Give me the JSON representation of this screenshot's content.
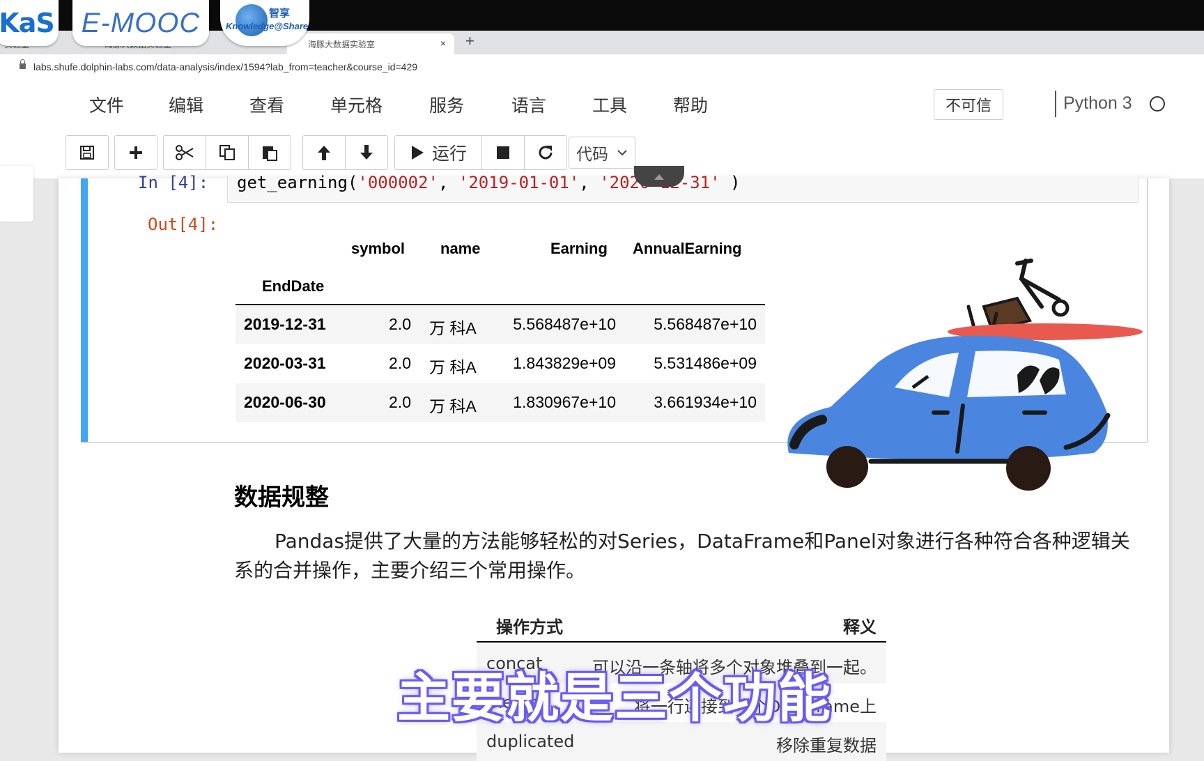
{
  "logos": {
    "kas": "KaS",
    "emooc": "E-MOOC",
    "ks_cn": "智享",
    "ks_en": "Knowledge@Share"
  },
  "browser": {
    "tabs": [
      "实验室",
      "海豚大数据实验室",
      "海豚大数据实验室"
    ],
    "active_tab_close": "×",
    "new_tab": "+",
    "url": "labs.shufe.dolphin-labs.com/data-analysis/index/1594?lab_from=teacher&course_id=429"
  },
  "menu": [
    "文件",
    "编辑",
    "查看",
    "单元格",
    "服务",
    "语言",
    "工具",
    "帮助"
  ],
  "trust_label": "不可信",
  "kernel_name": "Python 3",
  "toolbar": {
    "run_label": "运行",
    "cell_type": "代码"
  },
  "cell": {
    "in_prompt": "In  [4]:",
    "code_fn": "get_earning(",
    "code_arg1": "'000002'",
    "code_arg2": "'2019-01-01'",
    "code_arg3": "'2020-12-31'",
    "code_sep": ", ",
    "code_end": ")",
    "out_prompt": "Out[4]:"
  },
  "dataframe": {
    "columns": [
      "symbol",
      "name",
      "Earning",
      "AnnualEarning"
    ],
    "index_name": "EndDate",
    "rows": [
      {
        "EndDate": "2019-12-31",
        "symbol": "2.0",
        "name": "万 科A",
        "Earning": "5.568487e+10",
        "AnnualEarning": "5.568487e+10"
      },
      {
        "EndDate": "2020-03-31",
        "symbol": "2.0",
        "name": "万 科A",
        "Earning": "1.843829e+09",
        "AnnualEarning": "5.531486e+09"
      },
      {
        "EndDate": "2020-06-30",
        "symbol": "2.0",
        "name": "万 科A",
        "Earning": "1.830967e+10",
        "AnnualEarning": "3.661934e+10"
      }
    ]
  },
  "markdown": {
    "title": "数据规整",
    "paragraph": "Pandas提供了大量的方法能够轻松的对Series，DataFrame和Panel对象进行各种符合各种逻辑关系的合并操作，主要介绍三个常用操作。",
    "ops_table": {
      "headers": [
        "操作方式",
        "释义"
      ],
      "rows": [
        {
          "op": "concat",
          "def": "可以沿一条轴将多个对象堆叠到一起。"
        },
        {
          "op": "merge",
          "def": "将一行连接到一个DataFrame上"
        },
        {
          "op": "duplicated",
          "def": "移除重复数据"
        }
      ]
    }
  },
  "subtitle": "主要就是三个功能",
  "colors": {
    "cell_bar": "#42a5f5",
    "in_prompt": "#303f9f",
    "out_prompt": "#d84315",
    "string": "#ba2121",
    "subtitle_outline": "#6a5cf0",
    "car_body": "#4a86e0",
    "surfboard": "#e85a4f"
  }
}
